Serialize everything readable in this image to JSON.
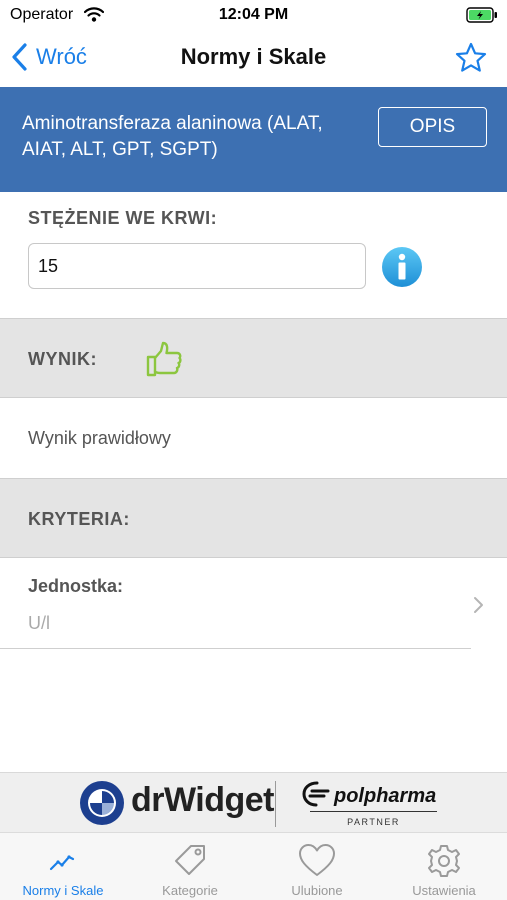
{
  "status_bar": {
    "carrier": "Operator",
    "time": "12:04 PM"
  },
  "nav": {
    "back_label": "Wróć",
    "title": "Normy i Skale"
  },
  "header": {
    "test_name": "Aminotransferaza alaninowa (ALAT, AIAT, ALT, GPT, SGPT)",
    "description_button": "OPIS"
  },
  "concentration": {
    "label": "STĘŻENIE WE KRWI:",
    "value": "15"
  },
  "result": {
    "label": "WYNIK:",
    "icon": "thumbs-up-icon",
    "text": "Wynik prawidłowy"
  },
  "criteria": {
    "label": "KRYTERIA:"
  },
  "unit": {
    "label": "Jednostka:",
    "value": "U/l"
  },
  "banner": {
    "drwidget": "drWidget",
    "polpharma": "polpharma",
    "partner": "PARTNER"
  },
  "tabs": [
    {
      "label": "Normy i Skale",
      "icon": "chart-line-icon",
      "active": true
    },
    {
      "label": "Kategorie",
      "icon": "tag-icon",
      "active": false
    },
    {
      "label": "Ulubione",
      "icon": "heart-icon",
      "active": false
    },
    {
      "label": "Ustawienia",
      "icon": "gear-icon",
      "active": false
    }
  ],
  "colors": {
    "accent": "#1a7fe8",
    "header_band": "#3d70b2",
    "thumb": "#8cc63f"
  }
}
